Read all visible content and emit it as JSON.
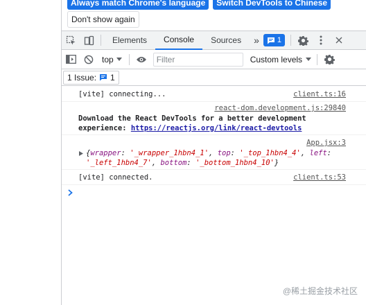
{
  "notice": {
    "match_language_label": "Always match Chrome's language",
    "switch_language_label": "Switch DevTools to Chinese",
    "dont_show_label": "Don't show again"
  },
  "tabs": {
    "items": [
      "Elements",
      "Console",
      "Sources"
    ],
    "active": "Console",
    "more_label": "»",
    "issues_count": "1"
  },
  "console_toolbar": {
    "context_label": "top",
    "filter_placeholder": "Filter",
    "levels_label": "Custom levels"
  },
  "issues_bar": {
    "label": "1 Issue:",
    "count": "1"
  },
  "messages": [
    {
      "text": "[vite] connecting...",
      "source": "client.ts:16"
    },
    {
      "source": "react-dom.development.js:29840",
      "line1": "Download the React DevTools for a better development",
      "line2_prefix": "experience: ",
      "link": "https://reactjs.org/link/react-devtools"
    },
    {
      "source": "App.jsx:3",
      "k1": "wrapper",
      "v1": "'_wrapper_1hbn4_1'",
      "k2": "top",
      "v2": "'_top_1hbn4_4'",
      "k3": "left",
      "v3": "'_left_1hbn4_7'",
      "k4": "bottom",
      "v4": "'_bottom_1hbn4_10'"
    },
    {
      "text": "[vite] connected.",
      "source": "client.ts:53"
    }
  ],
  "watermark": "@稀土掘金技术社区",
  "colors": {
    "accent": "#1a73e8",
    "link": "#1a1aa6",
    "string": "#c80000",
    "key": "#881280"
  }
}
